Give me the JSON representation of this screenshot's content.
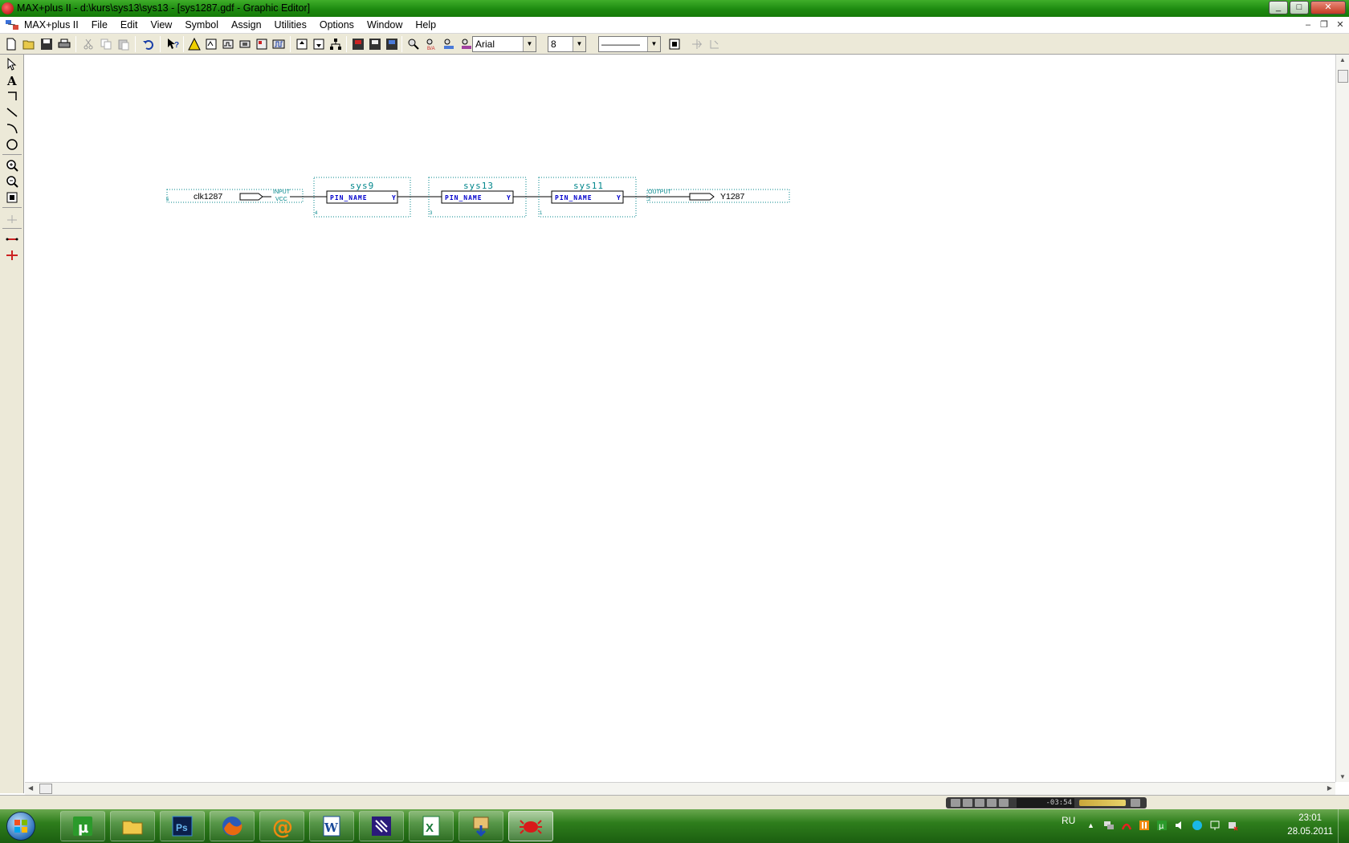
{
  "window": {
    "title": "MAX+plus II - d:\\kurs\\sys13\\sys13 - [sys1287.gdf - Graphic Editor]",
    "controls": [
      "_",
      "□",
      "✕"
    ]
  },
  "menubar": {
    "items": [
      "MAX+plus II",
      "File",
      "Edit",
      "View",
      "Symbol",
      "Assign",
      "Utilities",
      "Options",
      "Window",
      "Help"
    ]
  },
  "toolbar": {
    "font": "Arial",
    "font_size": "8",
    "line_style": "————",
    "buttons": [
      "new-icon",
      "open-icon",
      "save-icon",
      "print-icon",
      "cut-icon",
      "copy-icon",
      "paste-icon",
      "undo-icon",
      "help-pointer-icon",
      "compiler-icon",
      "simulator-icon",
      "timing-icon",
      "programmer-icon",
      "floorplan-icon",
      "waveform-icon",
      "hierarchy-up-icon",
      "hierarchy-down-icon",
      "hierarchy-display-icon",
      "save-check-icon",
      "save-compile-icon",
      "save-simulate-icon",
      "find-node-icon",
      "find-tags-icon",
      "find-clique-icon",
      "search-icon",
      "check-pins-icon",
      "flip-horizontal-icon",
      "rotate-icon"
    ]
  },
  "palette": {
    "tools": [
      "selection-arrow-icon",
      "text-tool-icon",
      "orthogonal-line-icon",
      "diagonal-line-icon",
      "arc-tool-icon",
      "circle-tool-icon",
      "zoom-in-icon",
      "zoom-out-icon",
      "fit-in-window-icon",
      "rubberband-icon",
      "connect-lines-icon",
      "disconnect-lines-icon"
    ]
  },
  "schematic": {
    "input_pin": {
      "name": "clk1287",
      "type_label": "INPUT",
      "vcc_label": "VCC",
      "number": "5"
    },
    "blocks": [
      {
        "title": "sys9",
        "port_in": "PIN_NAME",
        "port_out": "Y",
        "number": "4"
      },
      {
        "title": "sys13",
        "port_in": "PIN_NAME",
        "port_out": "Y",
        "number": "3"
      },
      {
        "title": "sys11",
        "port_in": "PIN_NAME",
        "port_out": "Y",
        "number": "1"
      }
    ],
    "output_pin": {
      "name": "Y1287",
      "type_label": "OUTPUT",
      "number": "2"
    }
  },
  "media_player": {
    "time": "-03:54"
  },
  "taskbar": {
    "apps": [
      "utorrent-icon",
      "explorer-icon",
      "photoshop-icon",
      "firefox-icon",
      "mail-agent-icon",
      "word-icon",
      "maxplus-icon",
      "excel-icon",
      "download-icon",
      "spider-icon"
    ],
    "active_index": 9
  },
  "tray": {
    "language": "RU",
    "time": "23:01",
    "date": "28.05.2011",
    "icons": [
      "show-hidden-icon",
      "network-icon",
      "antivirus-icon",
      "pause-icon",
      "app-tray-icon",
      "volume-icon",
      "skype-icon",
      "connection-icon",
      "safely-remove-icon"
    ]
  },
  "colors": {
    "title_bar": "#1d8a10",
    "taskbar": "#2e7d1c",
    "schematic_text": "#00868b",
    "port_text": "#0000cc",
    "canvas": "#ffffff"
  }
}
